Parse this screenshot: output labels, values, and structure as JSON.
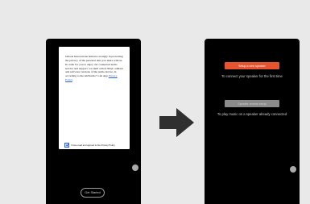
{
  "left_screen": {
    "privacy_text": "Gibson Innovations believes strongly in protecting the privacy of the personal data you share with us. In order for you to enjoy our connected audio service and support, we shall collect MAC address and software versions of the audio device, in according to the AirStudio+ Lite App",
    "privacy_link": "Privacy Policy",
    "privacy_text_end": ".",
    "agree_label": "I have read and agreed to the Privacy Policy",
    "agree_checked": true,
    "get_started_label": "Get Started"
  },
  "arrow": {
    "icon": "right-arrow-icon",
    "color": "#2f2f2f"
  },
  "right_screen": {
    "setup_new_label": "Setup a new speaker",
    "setup_new_caption": "To connect your speaker for the first time",
    "setup_remote_label": "Speaker remote setup",
    "setup_remote_caption": "To play music on a speaker already connected"
  },
  "colors": {
    "background": "#e9e9e9",
    "phone": "#000000",
    "accent": "#e5532f",
    "disabled": "#8b8b8b",
    "link": "#2b61d8"
  }
}
